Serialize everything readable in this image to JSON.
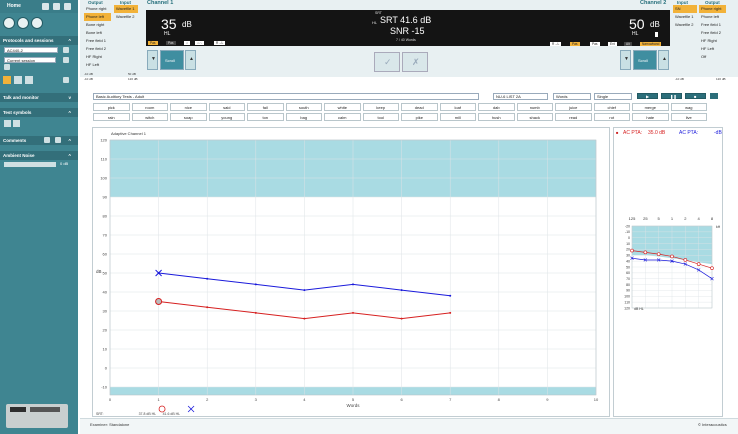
{
  "app": {
    "home_label": "Home"
  },
  "left_panel": {
    "sections": {
      "protocols": "Protocols and sessions",
      "talk": "Talk and monitor",
      "symbols": "Test symbols",
      "comments": "Comments",
      "noise": "Ambient Noise"
    },
    "protocol_value": "AC440-2",
    "session_value": "Current session",
    "noise_value": "0 dB"
  },
  "channel1": {
    "title": "Channel 1",
    "output_header": "Output",
    "input_header": "Input",
    "outputs": [
      "Phone right",
      "Phone left",
      "Bone right",
      "Bone left",
      "Free field 1",
      "Free field 2",
      "HF Right",
      "HF Left"
    ],
    "inputs": [
      "Wavefile 1",
      "Wavefile 2"
    ],
    "level": "35",
    "unit": "dB",
    "hl": "HL",
    "tags": [
      "Pas",
      "Pas",
      "∩",
      "∩∩",
      "R→L"
    ],
    "scroll_label": "Scroll",
    "scale_left": "-10 dB",
    "scale_right": "120 dB",
    "scale_min": "-10 dB",
    "scale_max": "50 dB"
  },
  "channel2": {
    "title": "Channel 2",
    "output_header": "Output",
    "input_header": "Input",
    "outputs": [
      "Phone right",
      "Phone left",
      "Free field 1",
      "Free field 2",
      "HF Right",
      "HF Left",
      "Off"
    ],
    "inputs": [
      "SN",
      "Wavefile 1",
      "Wavefile 2"
    ],
    "level": "50",
    "unit": "dB",
    "hl": "HL",
    "tags": [
      "R→L",
      "Pas",
      "Pas",
      "Ext",
      "Alt",
      "Narrowband"
    ],
    "scroll_label": "Scroll",
    "scale_left": "-10 dB",
    "scale_right": "120 dB"
  },
  "center_display": {
    "srt_label": "SRT",
    "srt_value": "SRT 41.6 dB",
    "hl": "HL",
    "snr": "SNR -15",
    "words_count": "7 / 40 Words"
  },
  "center_buttons": [
    "✓",
    "✗"
  ],
  "controls": {
    "test_select": "Basic Auditory Tests - Adult",
    "list_select": "NU-6 LIST 2A",
    "mode_select": "Words",
    "step_select": "Single"
  },
  "words": [
    [
      "pick",
      "room",
      "nice",
      "said",
      "fail",
      "south",
      "white",
      "keep",
      "dead",
      "loaf",
      "dab",
      "numb",
      "juice",
      "chief",
      "merge",
      "wag"
    ],
    [
      "rain",
      "witch",
      "soap",
      "young",
      "ton",
      "bag",
      "calm",
      "tool",
      "pike",
      "mill",
      "hush",
      "shack",
      "read",
      "rot",
      "hate",
      "live"
    ]
  ],
  "graph": {
    "title": "Adaptive Channel 1",
    "y_unit": "dB",
    "x_label": "Words",
    "legend": [
      {
        "key": "SRT",
        "value1": "37.8 dB HL",
        "value2": "41.6 dB HL"
      },
      {
        "key": "SNR",
        "value1": "-24",
        "value2": "-15"
      }
    ]
  },
  "chart_data": {
    "type": "line",
    "title": "Adaptive Channel 1",
    "xlabel": "Words",
    "ylabel": "dB",
    "x": [
      1,
      2,
      3,
      4,
      5,
      6,
      7
    ],
    "xlim": [
      0,
      10
    ],
    "ylim": [
      -10,
      120
    ],
    "xticks": [
      0,
      1,
      2,
      3,
      4,
      5,
      6,
      7,
      8,
      9,
      10
    ],
    "yticks": [
      -10,
      0,
      10,
      20,
      30,
      40,
      50,
      60,
      70,
      80,
      90,
      100,
      110,
      120
    ],
    "shaded_bands": [
      [
        90,
        120
      ],
      [
        -10,
        -15
      ]
    ],
    "series": [
      {
        "color": "#1a1adb",
        "values": [
          50,
          47,
          44,
          41,
          44,
          41,
          38
        ]
      },
      {
        "color": "#d62020",
        "values": [
          35,
          32,
          29,
          26,
          29,
          26,
          29
        ]
      }
    ],
    "grid": true
  },
  "right_panel": {
    "icon_label": "■",
    "ac_pta_label": "AC PTA:",
    "ac_pta_red": "35.0 dB",
    "ac_pta_blue": "-dB",
    "kHz": "kHz",
    "freqs": [
      "125",
      "25",
      "5",
      "1",
      "2",
      "4",
      "8"
    ],
    "db_label": "dB HL",
    "yticks": [
      "-20",
      "-10",
      "0",
      "10",
      "20",
      "30",
      "40",
      "50",
      "60",
      "70",
      "80",
      "90",
      "100",
      "110",
      "120"
    ],
    "red_curve": [
      22,
      25,
      28,
      32,
      38,
      45,
      52
    ],
    "blue_curve": [
      35,
      38,
      38,
      40,
      45,
      55,
      70
    ]
  },
  "footer": {
    "examiner": "Examiner: Standalone",
    "brand": "© Interacoustics"
  }
}
